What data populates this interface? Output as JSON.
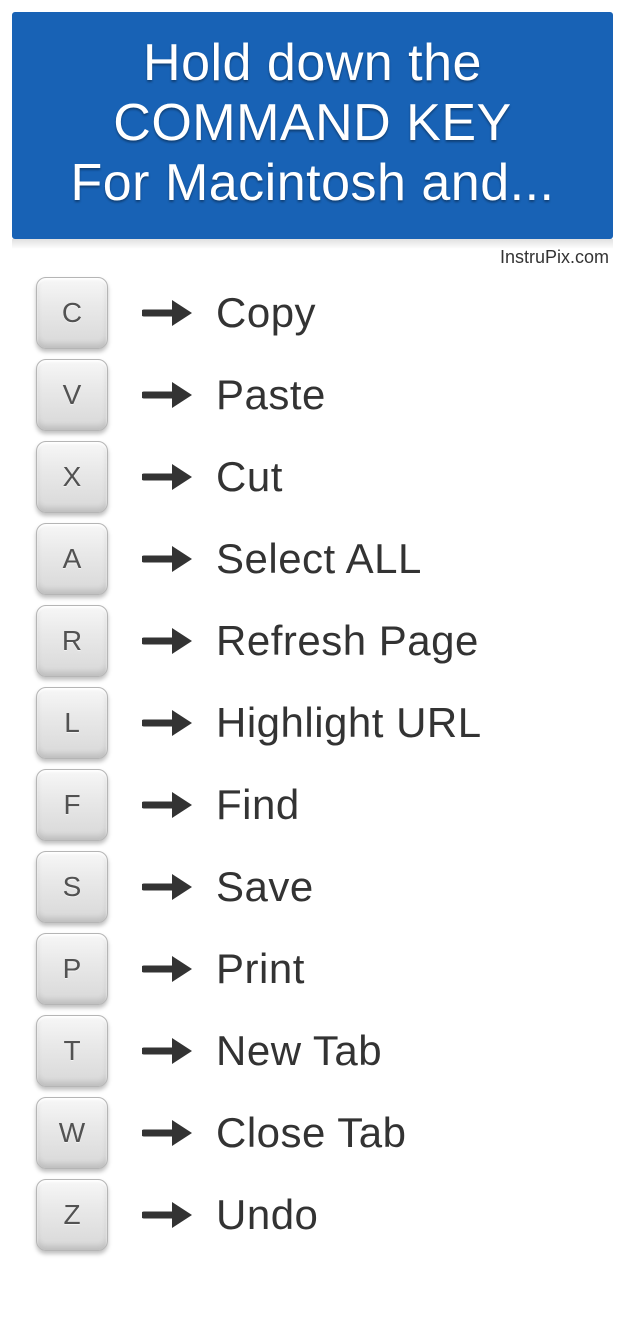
{
  "header": {
    "line1": "Hold down the",
    "line2": "COMMAND KEY",
    "line3": "For Macintosh and..."
  },
  "source": "InstruPix.com",
  "shortcuts": [
    {
      "key": "C",
      "action": "Copy"
    },
    {
      "key": "V",
      "action": "Paste"
    },
    {
      "key": "X",
      "action": "Cut"
    },
    {
      "key": "A",
      "action": "Select  ALL"
    },
    {
      "key": "R",
      "action": "Refresh Page"
    },
    {
      "key": "L",
      "action": "Highlight URL"
    },
    {
      "key": "F",
      "action": "Find"
    },
    {
      "key": "S",
      "action": "Save"
    },
    {
      "key": "P",
      "action": "Print"
    },
    {
      "key": "T",
      "action": "New Tab"
    },
    {
      "key": "W",
      "action": "Close Tab"
    },
    {
      "key": "Z",
      "action": "Undo"
    }
  ]
}
